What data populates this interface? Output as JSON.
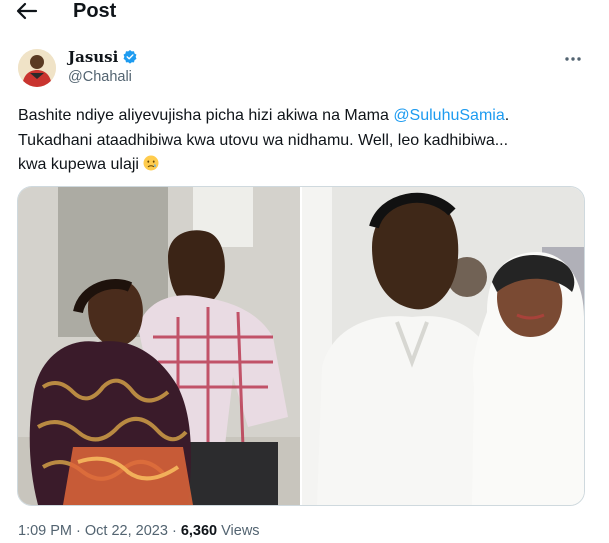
{
  "header": {
    "title": "Post",
    "back_icon": "arrow-left-icon"
  },
  "author": {
    "display_name": "Jasusi",
    "handle": "@Chahali",
    "verified_icon": "verified-badge-icon",
    "verified_color": "#1d9bf0",
    "avatar_icon": "avatar"
  },
  "tweet": {
    "line1_text": "Bashite ndiye aliyevujisha picha hizi akiwa na Mama ",
    "mention": "@SuluhuSamia",
    "line1_end": ".",
    "line2": "Tukadhani ataadhibiwa kwa utovu wa nidhamu. Well, leo kadhibiwa...",
    "line3": "kwa kupewa ulaji ",
    "emoji_icon": "crying-face-icon"
  },
  "media": {
    "count": 2
  },
  "meta": {
    "time": "1:09 PM",
    "separator": " · ",
    "date": "Oct 22, 2023",
    "separator2": " · ",
    "views_count": "6,360",
    "views_label": " Views"
  },
  "colors": {
    "text": "#0f1419",
    "secondary": "#536471",
    "link": "#1d9bf0",
    "border": "#cfd9de"
  }
}
